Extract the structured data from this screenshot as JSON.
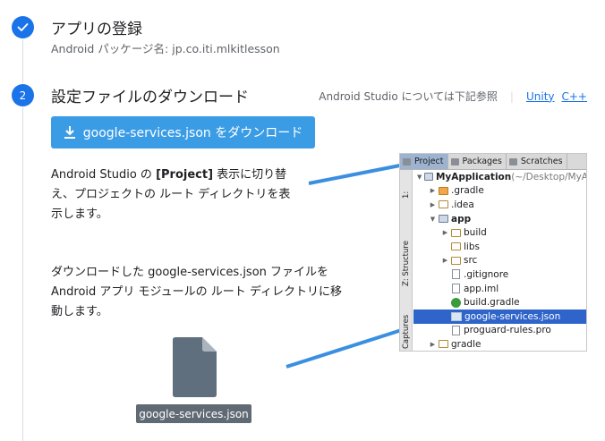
{
  "step1": {
    "title": "アプリの登録",
    "subtitle": "Android パッケージ名: jp.co.iti.mlkitlesson"
  },
  "step2": {
    "number": "2",
    "title": "設定ファイルのダウンロード",
    "ref_text": "Android Studio については下記参照",
    "links": [
      "Unity",
      "C++"
    ],
    "download_button": "google-services.json をダウンロード",
    "para1_pre": "Android Studio の ",
    "para1_bold": "[Project]",
    "para1_post": " 表示に切り替え、プロジェクトの ルート ディレクトリを表示します。",
    "para2": "ダウンロードした google-services.json ファイルを Android アプリ モジュールの ルート ディレクトリに移動します。",
    "file_label": "google-services.json"
  },
  "ide": {
    "tabs": [
      "Project",
      "Packages",
      "Scratches"
    ],
    "side_labels": [
      "1:",
      "Z: Structure",
      "Captures"
    ],
    "tree": [
      {
        "indent": 0,
        "twisty": "▼",
        "icon": "module",
        "label": "MyApplication",
        "bold": true,
        "suffix": " (~/Desktop/MyA"
      },
      {
        "indent": 1,
        "twisty": "▶",
        "icon": "folder-orange",
        "label": ".gradle"
      },
      {
        "indent": 1,
        "twisty": "▶",
        "icon": "folder",
        "label": ".idea"
      },
      {
        "indent": 1,
        "twisty": "▼",
        "icon": "module",
        "label": "app",
        "bold": true
      },
      {
        "indent": 2,
        "twisty": "▶",
        "icon": "folder",
        "label": "build"
      },
      {
        "indent": 2,
        "twisty": "",
        "icon": "folder",
        "label": "libs"
      },
      {
        "indent": 2,
        "twisty": "▶",
        "icon": "folder",
        "label": "src"
      },
      {
        "indent": 2,
        "twisty": "",
        "icon": "file",
        "label": ".gitignore"
      },
      {
        "indent": 2,
        "twisty": "",
        "icon": "file",
        "label": "app.iml"
      },
      {
        "indent": 2,
        "twisty": "",
        "icon": "gradle",
        "label": "build.gradle"
      },
      {
        "indent": 2,
        "twisty": "",
        "icon": "json",
        "label": "google-services.json",
        "selected": true
      },
      {
        "indent": 2,
        "twisty": "",
        "icon": "file",
        "label": "proguard-rules.pro"
      },
      {
        "indent": 1,
        "twisty": "▶",
        "icon": "folder",
        "label": "gradle"
      }
    ]
  },
  "colors": {
    "accent": "#1a73e8",
    "button": "#3b9ce6",
    "arrow": "#3b8fe0",
    "selection": "#2f65ca"
  },
  "icons": {
    "step1": "checkmark-icon",
    "download": "download-icon",
    "file": "document-file-icon"
  }
}
